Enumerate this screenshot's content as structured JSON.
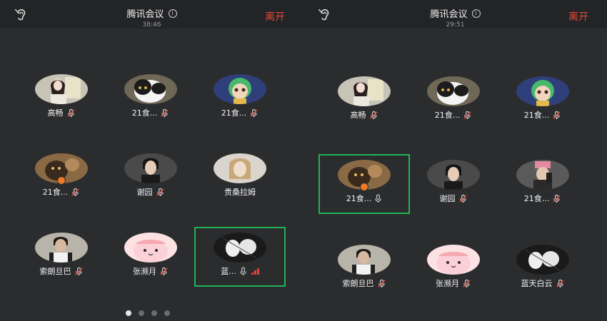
{
  "left": {
    "title": "腾讯会议",
    "info_icon": "info-icon",
    "time": "38:46",
    "leave": "离开",
    "participants": [
      {
        "name": "高畅",
        "state": "muted"
      },
      {
        "name": "21食...",
        "state": "muted"
      },
      {
        "name": "21食...",
        "state": "muted"
      },
      {
        "name": "21食...",
        "state": "muted"
      },
      {
        "name": "谢园",
        "state": "muted"
      },
      {
        "name": "贵桑拉姆",
        "state": "none"
      },
      {
        "name": "索朗旦巴",
        "state": "muted"
      },
      {
        "name": "张濒月",
        "state": "muted"
      },
      {
        "name": "蓝...",
        "state": "speaking"
      }
    ],
    "page_dots": 4,
    "page_current": 1
  },
  "right": {
    "title": "腾讯会议",
    "info_icon": "info-icon",
    "time": "29:51",
    "leave": "离开",
    "participants": [
      {
        "name": "高畅",
        "state": "muted"
      },
      {
        "name": "21食...",
        "state": "muted"
      },
      {
        "name": "21食...",
        "state": "muted"
      },
      {
        "name": "21食...",
        "state": "mic"
      },
      {
        "name": "谢园",
        "state": "muted"
      },
      {
        "name": "21食...",
        "state": "muted"
      },
      {
        "name": "索朗旦巴",
        "state": "muted"
      },
      {
        "name": "张濒月",
        "state": "muted"
      },
      {
        "name": "蓝天白云",
        "state": "muted"
      }
    ]
  },
  "colors": {
    "accent_active": "#1fb356",
    "leave": "#e8463a",
    "background": "#2b2c2e"
  }
}
